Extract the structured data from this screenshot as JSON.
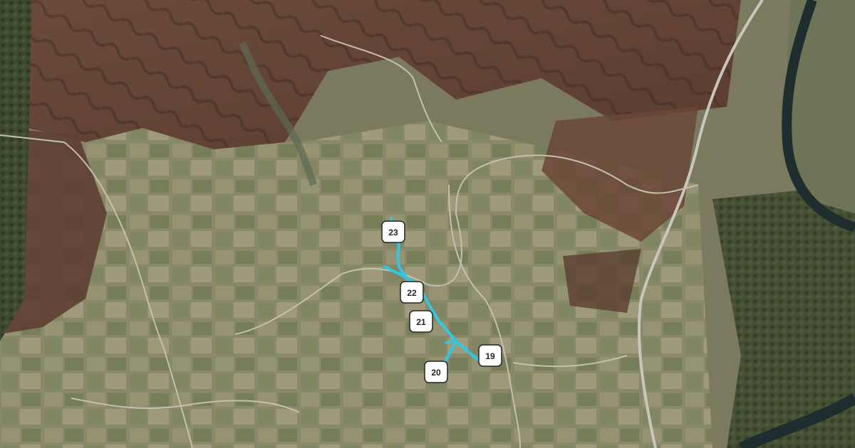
{
  "map": {
    "type": "satellite",
    "route_color": "#2ec8e6",
    "markers": [
      {
        "id": "m19",
        "label": "19"
      },
      {
        "id": "m20",
        "label": "20"
      },
      {
        "id": "m21",
        "label": "21"
      },
      {
        "id": "m22",
        "label": "22"
      },
      {
        "id": "m23",
        "label": "23"
      }
    ]
  }
}
